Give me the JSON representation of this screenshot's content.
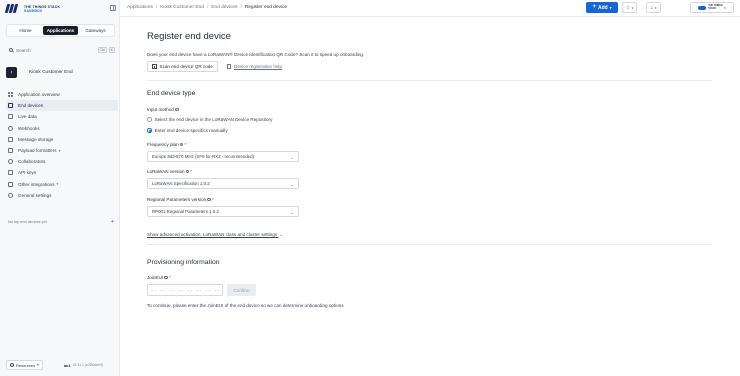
{
  "brand": {
    "line1": "THE THINGS STACK",
    "line2": "SANDBOX"
  },
  "sidebar": {
    "segments": [
      "Home",
      "Applications",
      "Gateways"
    ],
    "active_segment": "Applications",
    "search": {
      "label": "Search",
      "shortcut_keys": [
        "Ctrl",
        "K"
      ]
    },
    "app_name": "Kiosk Customer End",
    "items": [
      {
        "label": "Application overview",
        "icon": "grid-icon"
      },
      {
        "label": "End devices",
        "icon": "device-icon",
        "active": true
      },
      {
        "label": "Live data",
        "icon": "list-icon"
      },
      {
        "label": "Webhooks",
        "icon": "webhook-icon"
      },
      {
        "label": "Message storage",
        "icon": "database-icon"
      },
      {
        "label": "Payload formatters",
        "icon": "code-icon",
        "expandable": true
      },
      {
        "label": "Collaborators",
        "icon": "users-icon"
      },
      {
        "label": "API keys",
        "icon": "key-icon"
      },
      {
        "label": "Other integrations",
        "icon": "integrations-icon",
        "expandable": true
      },
      {
        "label": "General settings",
        "icon": "gear-icon"
      }
    ],
    "top_devices_empty": "No top end devices yet",
    "footer": {
      "resources_label": "Resources",
      "cluster": "au1",
      "version": "v3.34.1 (a2f50dee9)"
    }
  },
  "topbar": {
    "breadcrumbs": [
      "Applications",
      "Kiosk Customer End",
      "End devices",
      "Register end device"
    ],
    "add_label": "Add",
    "account_logo_lines": [
      "THE THINGS",
      "STACK"
    ]
  },
  "page": {
    "title": "Register end device",
    "qr_prompt": "Does your end device have a LoRaWAN® Device Identification QR Code? Scan it to speed up onboarding.",
    "scan_button": "Scan end device QR code",
    "help_link": "Device registration help",
    "end_device_type": {
      "title": "End device type",
      "input_method_label": "Input method",
      "options": [
        {
          "label": "Select the end device in the LoRaWAN Device Repository",
          "checked": false
        },
        {
          "label": "Enter end device specifics manually",
          "checked": true
        }
      ],
      "frequency_plan": {
        "label": "Frequency plan",
        "value": "Europe 863-870 MHz (SF9 for RX2 - recommended)"
      },
      "lorawan_version": {
        "label": "LoRaWAN version",
        "value": "LoRaWAN Specification 1.0.2"
      },
      "regional_params": {
        "label": "Regional Parameters version",
        "value": "RP001 Regional Parameters 1.0.2"
      },
      "advanced_link": "Show advanced activation, LoRaWAN class and cluster settings"
    },
    "provisioning": {
      "title": "Provisioning information",
      "joineui_label": "JoinEUI",
      "joineui_value": "-- -- -- -- -- -- -- --",
      "confirm_button": "Confirm",
      "help_text": "To continue, please enter the JoinEUI of the end device so we can determine onboarding options"
    }
  },
  "colors": {
    "accent": "#1766d6",
    "brand_dark": "#1b2c6b",
    "active_segment_bg": "#181e2b"
  }
}
